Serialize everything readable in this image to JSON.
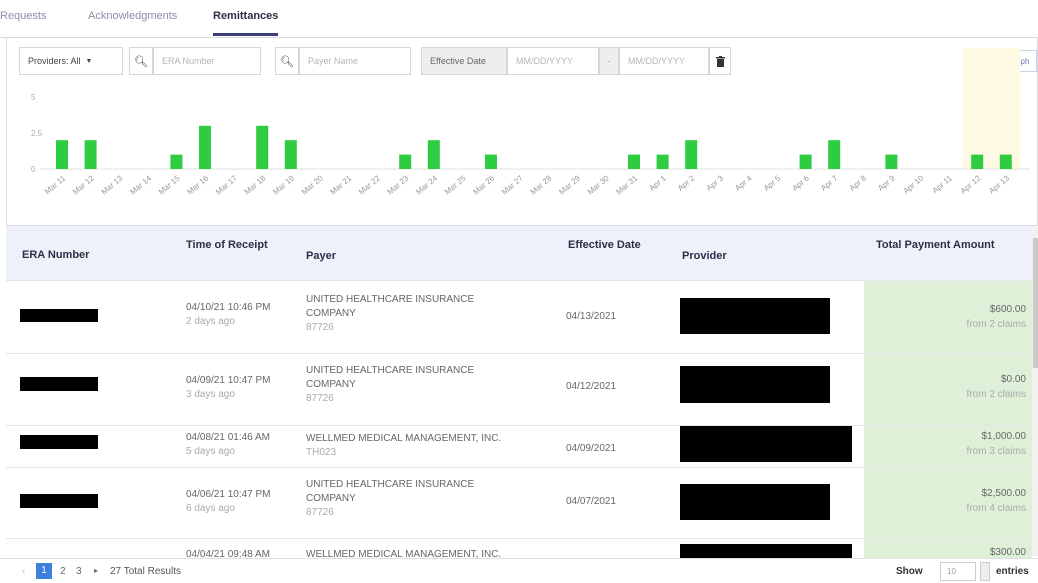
{
  "tabs": [
    {
      "label": "Requests",
      "active": false
    },
    {
      "label": "Acknowledgments",
      "active": false
    },
    {
      "label": "Remittances",
      "active": true
    }
  ],
  "filters": {
    "providers_label": "Providers: All",
    "era_placeholder": "ERA Number",
    "payer_placeholder": "Payer Name",
    "effective_date_label": "Effective Date",
    "date_from_placeholder": "MM/DD/YYYY",
    "date_sep": "-",
    "date_to_placeholder": "MM/DD/YYYY",
    "hide_graph_label": "Hide Graph"
  },
  "colors": {
    "bar": "#2ecc40",
    "highlight": "#fdf9e3",
    "active_tab_underline": "#3a3f78",
    "amount_bg": "#dff0d8",
    "page_active": "#3d7fd9"
  },
  "chart_data": {
    "type": "bar",
    "categories": [
      "Mar 11",
      "Mar 12",
      "Mar 13",
      "Mar 14",
      "Mar 15",
      "Mar 16",
      "Mar 17",
      "Mar 18",
      "Mar 19",
      "Mar 20",
      "Mar 21",
      "Mar 22",
      "Mar 23",
      "Mar 24",
      "Mar 25",
      "Mar 26",
      "Mar 27",
      "Mar 28",
      "Mar 29",
      "Mar 30",
      "Mar 31",
      "Apr 1",
      "Apr 2",
      "Apr 3",
      "Apr 4",
      "Apr 5",
      "Apr 6",
      "Apr 7",
      "Apr 8",
      "Apr 9",
      "Apr 10",
      "Apr 11",
      "Apr 12",
      "Apr 13"
    ],
    "values": [
      2,
      2,
      0,
      0,
      1,
      3,
      0,
      3,
      2,
      0,
      0,
      0,
      1,
      2,
      0,
      1,
      0,
      0,
      0,
      0,
      1,
      1,
      2,
      0,
      0,
      0,
      1,
      2,
      0,
      1,
      0,
      0,
      1,
      1
    ],
    "y_ticks": [
      "5",
      "2.5",
      "0"
    ],
    "ylim": [
      0,
      5
    ],
    "highlight_categories": [
      "Apr 12",
      "Apr 13"
    ],
    "grid": false,
    "legend": "none"
  },
  "table": {
    "headers": {
      "era": "ERA Number",
      "time": "Time of Receipt",
      "payer": "Payer",
      "effective": "Effective Date",
      "provider": "Provider",
      "total": "Total Payment Amount"
    },
    "rows": [
      {
        "time": "04/10/21 10:46 PM",
        "ago": "2 days ago",
        "payer_l1": "UNITED HEALTHCARE INSURANCE",
        "payer_l2": "COMPANY",
        "payer_code": "87726",
        "effective": "04/13/2021",
        "amount": "$600.00",
        "from": "from 2 claims"
      },
      {
        "time": "04/09/21 10:47 PM",
        "ago": "3 days ago",
        "payer_l1": "UNITED HEALTHCARE INSURANCE",
        "payer_l2": "COMPANY",
        "payer_code": "87726",
        "effective": "04/12/2021",
        "amount": "$0.00",
        "from": "from 2 claims"
      },
      {
        "time": "04/08/21 01:46 AM",
        "ago": "5 days ago",
        "payer_l1": "WELLMED MEDICAL MANAGEMENT, INC.",
        "payer_l2": "",
        "payer_code": "TH023",
        "effective": "04/09/2021",
        "amount": "$1,000.00",
        "from": "from 3 claims"
      },
      {
        "time": "04/06/21 10:47 PM",
        "ago": "6 days ago",
        "payer_l1": "UNITED HEALTHCARE INSURANCE",
        "payer_l2": "COMPANY",
        "payer_code": "87726",
        "effective": "04/07/2021",
        "amount": "$2,500.00",
        "from": "from 4 claims"
      },
      {
        "time": "04/04/21 09:48 AM",
        "ago": "",
        "payer_l1": "WELLMED MEDICAL MANAGEMENT, INC.",
        "payer_l2": "",
        "payer_code": "",
        "effective": "",
        "amount": "$300.00",
        "from": ""
      }
    ]
  },
  "pagination": {
    "prev": "‹",
    "pages": [
      "1",
      "2",
      "3"
    ],
    "next": "▸",
    "total_results": "27 Total Results",
    "show_label": "Show",
    "page_size": "10",
    "entries_label": "entries"
  }
}
